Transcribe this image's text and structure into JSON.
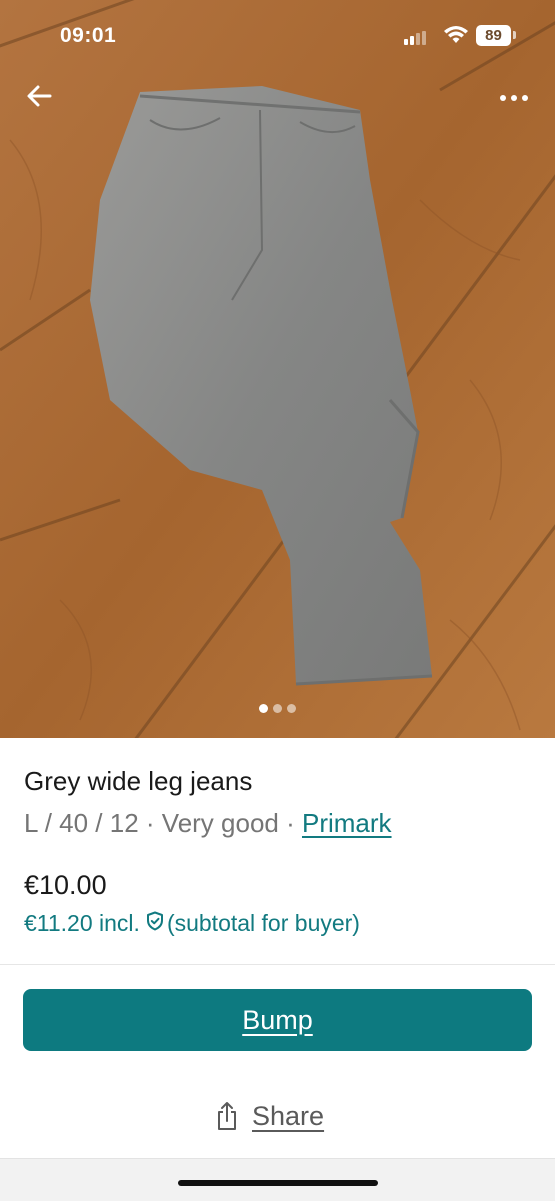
{
  "status_bar": {
    "time": "09:01",
    "battery": "89"
  },
  "photo": {
    "page_count": 3,
    "active_index": 0,
    "alt": "Grey wide leg jeans"
  },
  "item": {
    "title": "Grey wide leg jeans",
    "meta": "L / 40 / 12 · Very good · ",
    "brand": "Primark",
    "price": "€10.00",
    "buyer_price": "€11.20 incl.",
    "buyer_note": "(subtotal for buyer)"
  },
  "actions": {
    "bump_label": "Bump",
    "share_label": "Share"
  },
  "colors": {
    "accent": "#0d7a80",
    "link": "#127a80",
    "text": "#1a1a1a",
    "muted": "#757575"
  }
}
